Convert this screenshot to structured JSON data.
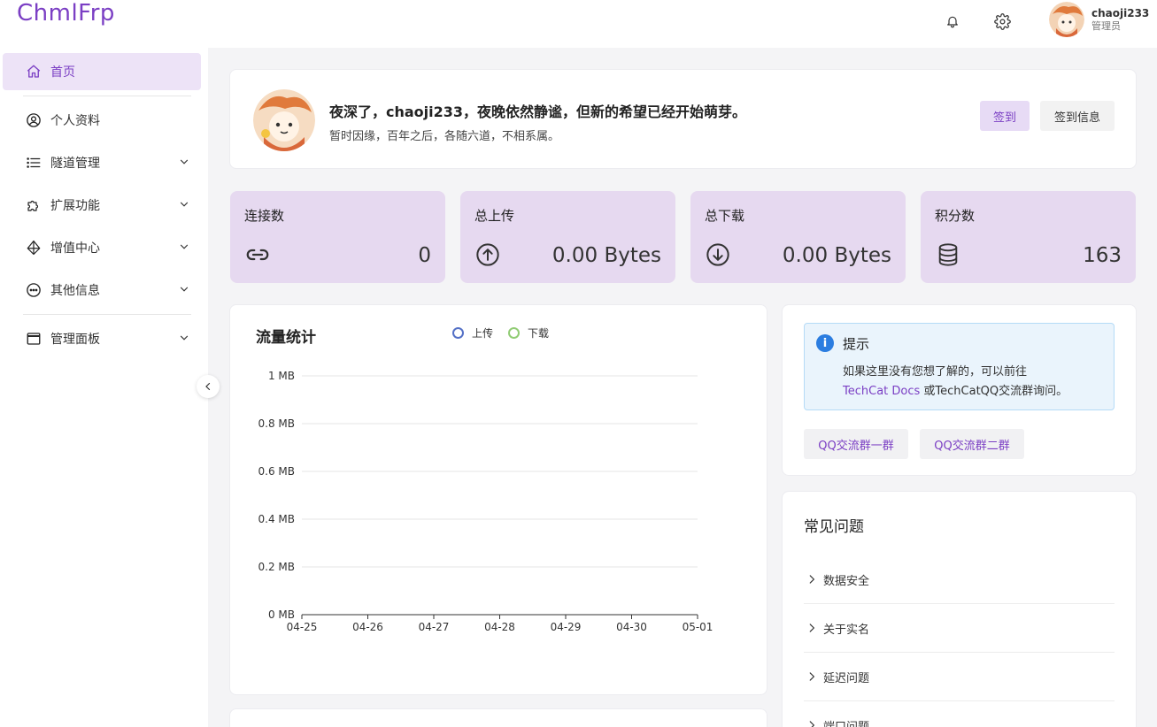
{
  "app": {
    "title": "ChmlFrp"
  },
  "header": {
    "user_name": "chaoji233",
    "user_role": "管理员"
  },
  "sidebar": {
    "items": [
      {
        "label": "首页",
        "icon": "home-icon"
      },
      {
        "label": "个人资料",
        "icon": "user-circle-icon"
      },
      {
        "label": "隧道管理",
        "icon": "list-icon"
      },
      {
        "label": "扩展功能",
        "icon": "puzzle-icon"
      },
      {
        "label": "增值中心",
        "icon": "diamond-icon"
      },
      {
        "label": "其他信息",
        "icon": "more-circle-icon"
      },
      {
        "label": "管理面板",
        "icon": "window-icon"
      }
    ]
  },
  "welcome": {
    "greeting": "夜深了，chaoji233，夜晚依然静谧，但新的希望已经开始萌芽。",
    "quote": "暂时因缘，百年之后，各随六道，不相系属。",
    "sign_label": "签到",
    "sign_info_label": "签到信息"
  },
  "stats": [
    {
      "label": "连接数",
      "value": "0",
      "icon": "link-icon"
    },
    {
      "label": "总上传",
      "value": "0.00 Bytes",
      "icon": "arrow-up-circle-icon"
    },
    {
      "label": "总下载",
      "value": "0.00 Bytes",
      "icon": "arrow-down-circle-icon"
    },
    {
      "label": "积分数",
      "value": "163",
      "icon": "database-icon"
    }
  ],
  "traffic": {
    "title": "流量统计"
  },
  "chart_data": {
    "type": "line",
    "title": "流量统计",
    "categories": [
      "04-25",
      "04-26",
      "04-27",
      "04-28",
      "04-29",
      "04-30",
      "05-01"
    ],
    "y_ticks": [
      "1 MB",
      "0.8 MB",
      "0.6 MB",
      "0.4 MB",
      "0.2 MB",
      "0 MB"
    ],
    "ylim": [
      0,
      1
    ],
    "series": [
      {
        "name": "上传",
        "color": "#5470c6",
        "values": []
      },
      {
        "name": "下载",
        "color": "#91cc75",
        "values": []
      }
    ],
    "legend": "top"
  },
  "tips": {
    "title": "提示",
    "text1": "如果这里没有您想了解的，可以前往",
    "link": "TechCat Docs",
    "text2": "或TechCatQQ交流群询问。",
    "qq1_label": "QQ交流群一群",
    "qq2_label": "QQ交流群二群"
  },
  "faq": {
    "title": "常见问题",
    "items": [
      "数据安全",
      "关于实名",
      "延迟问题",
      "端口问题"
    ]
  },
  "colors": {
    "accent": "#7b3fc4",
    "stat_bg": "#e6d9f0",
    "active_bg": "#ede3f7"
  }
}
